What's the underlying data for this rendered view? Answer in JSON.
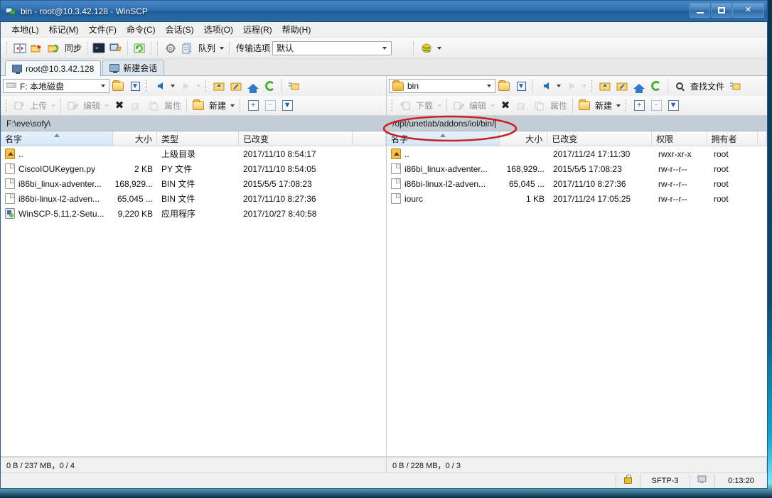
{
  "window": {
    "title": "bin - root@10.3.42.128 - WinSCP",
    "icon": "winscp-icon",
    "minimize_label": "Minimize",
    "maximize_label": "Maximize",
    "close_label": "✕"
  },
  "menubar": [
    {
      "label": "本地(L)",
      "name": "menu-local"
    },
    {
      "label": "标记(M)",
      "name": "menu-mark"
    },
    {
      "label": "文件(F)",
      "name": "menu-file"
    },
    {
      "label": "命令(C)",
      "name": "menu-command"
    },
    {
      "label": "会话(S)",
      "name": "menu-session"
    },
    {
      "label": "选项(O)",
      "name": "menu-options"
    },
    {
      "label": "远程(R)",
      "name": "menu-remote"
    },
    {
      "label": "帮助(H)",
      "name": "menu-help"
    }
  ],
  "toolbar": {
    "sync_browsing_label": "",
    "sync_label": "同步",
    "queue_label": "队列",
    "transfer_options_label": "传输选项",
    "transfer_options_value": "默认"
  },
  "tabs": [
    {
      "label": "root@10.3.42.128",
      "active": true
    },
    {
      "label": "新建会话",
      "active": false
    }
  ],
  "left_panel": {
    "drive_label": "F: 本地磁盘",
    "path": "F:\\eve\\sofy\\",
    "upload_label": "上传",
    "edit_label": "编辑",
    "properties_label": "属性",
    "new_label": "新建",
    "columns": [
      {
        "label": "名字",
        "width": 158,
        "align": "left",
        "sorted": true
      },
      {
        "label": "大小",
        "width": 62,
        "align": "right",
        "sorted": false
      },
      {
        "label": "类型",
        "width": 115,
        "align": "left",
        "sorted": false
      },
      {
        "label": "已改变",
        "width": 160,
        "align": "left",
        "sorted": false
      },
      {
        "label": "",
        "width": 48,
        "align": "left",
        "sorted": false
      }
    ],
    "rows": [
      {
        "icon": "parent-directory-icon",
        "name": "..",
        "size": "",
        "type": "上级目录",
        "changed": "2017/11/10  8:54:17"
      },
      {
        "icon": "file-icon",
        "name": "CiscoIOUKeygen.py",
        "size": "2 KB",
        "type": "PY 文件",
        "changed": "2017/11/10  8:54:05"
      },
      {
        "icon": "file-icon",
        "name": "i86bi_linux-adventer...",
        "size": "168,929...",
        "type": "BIN 文件",
        "changed": "2015/5/5  17:08:23"
      },
      {
        "icon": "file-icon",
        "name": "i86bi-linux-l2-adven...",
        "size": "65,045 ...",
        "type": "BIN 文件",
        "changed": "2017/11/10  8:27:36"
      },
      {
        "icon": "application-icon",
        "name": "WinSCP-5.11.2-Setu...",
        "size": "9,220 KB",
        "type": "应用程序",
        "changed": "2017/10/27  8:40:58"
      }
    ],
    "status": "0 B / 237 MB，0 / 4"
  },
  "right_panel": {
    "dir_label": "bin",
    "path": "/opt/unetlab/addons/iol/bin/",
    "find_files_label": "查找文件",
    "download_label": "下载",
    "edit_label": "编辑",
    "properties_label": "属性",
    "new_label": "新建",
    "columns": [
      {
        "label": "名字",
        "width": 160,
        "align": "left",
        "sorted": true
      },
      {
        "label": "大小",
        "width": 68,
        "align": "right",
        "sorted": false
      },
      {
        "label": "已改变",
        "width": 148,
        "align": "left",
        "sorted": false
      },
      {
        "label": "权限",
        "width": 78,
        "align": "left",
        "sorted": false
      },
      {
        "label": "拥有者",
        "width": 72,
        "align": "left",
        "sorted": false
      },
      {
        "label": "",
        "width": 16,
        "align": "left",
        "sorted": false
      }
    ],
    "rows": [
      {
        "icon": "parent-directory-icon",
        "name": "..",
        "size": "",
        "changed": "2017/11/24 17:11:30",
        "perms": "rwxr-xr-x",
        "owner": "root"
      },
      {
        "icon": "file-icon",
        "name": "i86bi_linux-adventer...",
        "size": "168,929...",
        "changed": "2015/5/5 17:08:23",
        "perms": "rw-r--r--",
        "owner": "root"
      },
      {
        "icon": "file-icon",
        "name": "i86bi-linux-l2-adven...",
        "size": "65,045 ...",
        "changed": "2017/11/10 8:27:36",
        "perms": "rw-r--r--",
        "owner": "root"
      },
      {
        "icon": "file-icon",
        "name": "iourc",
        "size": "1 KB",
        "changed": "2017/11/24 17:05:25",
        "perms": "rw-r--r--",
        "owner": "root"
      }
    ],
    "status": "0 B / 228 MB，0 / 3"
  },
  "statusbar": {
    "protocol": "SFTP-3",
    "duration": "0:13:20",
    "lock_icon": "lock-icon",
    "monitor_icon": "monitor-icon"
  },
  "annotation": {
    "shape": "red-ellipse",
    "color": "#cc1f1f",
    "target": "/opt/unetlab/addons/iol/bin/"
  },
  "colors": {
    "titlebar": "#2f6fb0",
    "path_bar": "#c3cdd6",
    "accent": "#2f79c8",
    "annotation": "#cc1f1f"
  }
}
